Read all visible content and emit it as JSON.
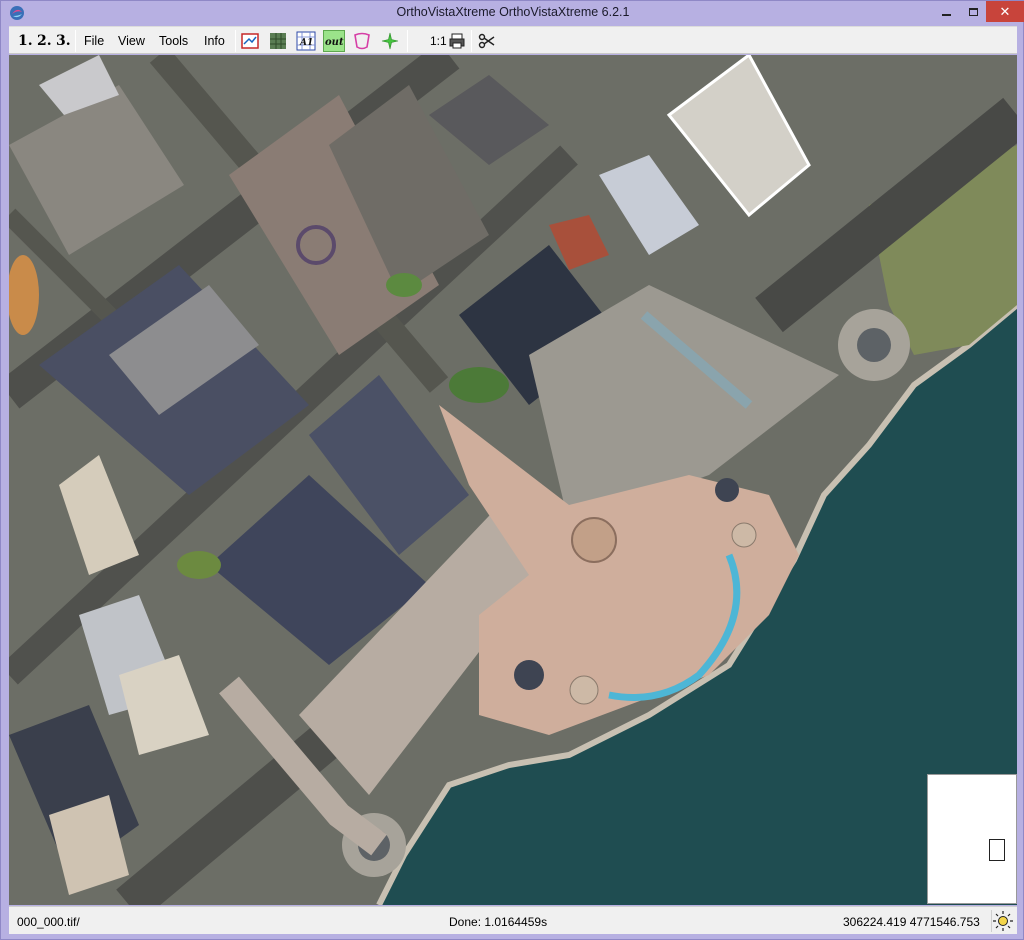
{
  "window": {
    "title": "OrthoVistaXtreme OrthoVistaXtreme 6.2.1",
    "icons": {
      "app": "app-logo-icon",
      "minimize": "minimize-icon",
      "maximize": "maximize-icon",
      "close": "close-icon"
    }
  },
  "steps": [
    "1.",
    "2.",
    "3."
  ],
  "menu": {
    "file": "File",
    "view": "View",
    "tools": "Tools",
    "info": "Info"
  },
  "toolbar": {
    "tools": [
      "image-frame-icon",
      "mosaic-grid-icon",
      "a1-text-icon",
      "out-icon",
      "seamline-icon",
      "sparkle-icon"
    ],
    "zoom_ratio": "1:1",
    "print_icon": "printer-icon",
    "cut_icon": "scissors-icon",
    "text_a1": "A1",
    "text_out": "out"
  },
  "map": {
    "description_icon": "aerial-orthophoto-view"
  },
  "status": {
    "file": "000_000.tif/",
    "done": "Done: 1.0164459s",
    "coords": "306224.419 4771546.753",
    "sun_icon": "sun-icon"
  },
  "colors": {
    "frame": "#b7b0e2",
    "close_button": "#c8443b",
    "water": "#1f4e52",
    "pavement": "#d6b8a8"
  }
}
